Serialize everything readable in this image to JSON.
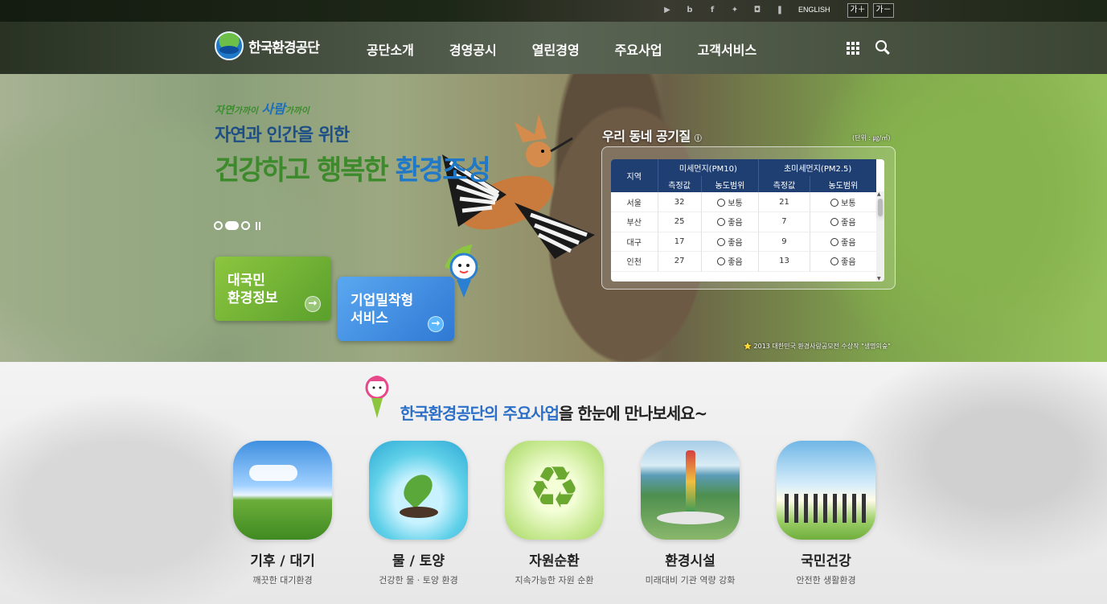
{
  "util": {
    "sns": [
      "youtube-icon",
      "blog-icon",
      "facebook-icon",
      "twitter-icon",
      "instagram-icon",
      "kakao-icon"
    ],
    "english": "ENGLISH",
    "font_up": "가＋",
    "font_down": "가－"
  },
  "header": {
    "logo_text": "한국환경공단",
    "menu": [
      "공단소개",
      "경영공시",
      "열린경영",
      "주요사업",
      "고객서비스"
    ]
  },
  "hero": {
    "tagline_a": "자연",
    "tagline_b": "가까이",
    "tagline_c": "사람",
    "tagline_d": "가까이",
    "slogan1": "자연과 인간을 위한",
    "slogan2_a": "건강하고 ",
    "slogan2_b": "행복한 ",
    "slogan2_c": "환경조성",
    "btn_env_1": "대국민",
    "btn_env_2": "환경정보",
    "btn_biz_1": "기업밀착형",
    "btn_biz_2": "서비스",
    "credit": "2013 대한민국 환경사랑공모전 수상작 \"생명의숲\""
  },
  "air": {
    "title": "우리 동네 공기질",
    "unit": "(단위 : ㎍/㎥)",
    "headers": {
      "region": "지역",
      "pm10": "미세먼지(PM10)",
      "pm25": "초미세먼지(PM2.5)",
      "measured": "측정값",
      "range": "농도범위"
    },
    "rows": [
      {
        "region": "서울",
        "pm10": "32",
        "pm10_grade": "보통",
        "pm25": "21",
        "pm25_grade": "보통"
      },
      {
        "region": "부산",
        "pm10": "25",
        "pm10_grade": "좋음",
        "pm25": "7",
        "pm25_grade": "좋음"
      },
      {
        "region": "대구",
        "pm10": "17",
        "pm10_grade": "좋음",
        "pm25": "9",
        "pm25_grade": "좋음"
      },
      {
        "region": "인천",
        "pm10": "27",
        "pm10_grade": "좋음",
        "pm25": "13",
        "pm25_grade": "좋음"
      }
    ]
  },
  "biz": {
    "title_hl": "한국환경공단의 주요사업",
    "title_rest": "을 한눈에 만나보세요~",
    "cards": [
      {
        "title": "기후 / 대기",
        "desc": "깨끗한 대기환경"
      },
      {
        "title": "물 / 토양",
        "desc": "건강한 물 · 토양 환경"
      },
      {
        "title": "자원순환",
        "desc": "지속가능한 자원 순환"
      },
      {
        "title": "환경시설",
        "desc": "미래대비 기관 역량 강화"
      },
      {
        "title": "국민건강",
        "desc": "안전한 생활환경"
      }
    ]
  },
  "colors": {
    "header_bg": "#2a3622",
    "table_head": "#1f3f73",
    "green_btn": "#6fb033",
    "blue_btn": "#3a86dc",
    "accent_blue": "#2c6fc7",
    "accent_green": "#3d8a2c"
  }
}
